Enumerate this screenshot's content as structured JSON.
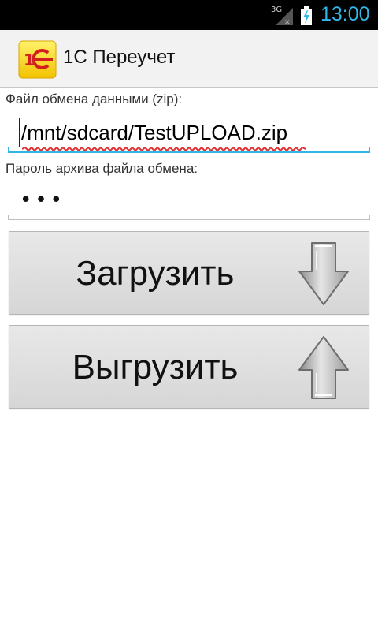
{
  "status_bar": {
    "network": "3G",
    "signal_icon": "signal-icon",
    "battery_icon": "battery-charging-icon",
    "time": "13:00",
    "clock_color": "#33b5e5"
  },
  "action_bar": {
    "logo": "1c-logo",
    "title": "1С Переучет"
  },
  "form": {
    "file_label": "Файл обмена данными (zip):",
    "file_value": "/mnt/sdcard/TestUPLOAD.zip",
    "password_label": "Пароль архива файла обмена:",
    "password_value": "•••"
  },
  "buttons": {
    "load_label": "Загрузить",
    "load_icon": "arrow-down-icon",
    "unload_label": "Выгрузить",
    "unload_icon": "arrow-up-icon"
  },
  "accent_color": "#33b5e5"
}
